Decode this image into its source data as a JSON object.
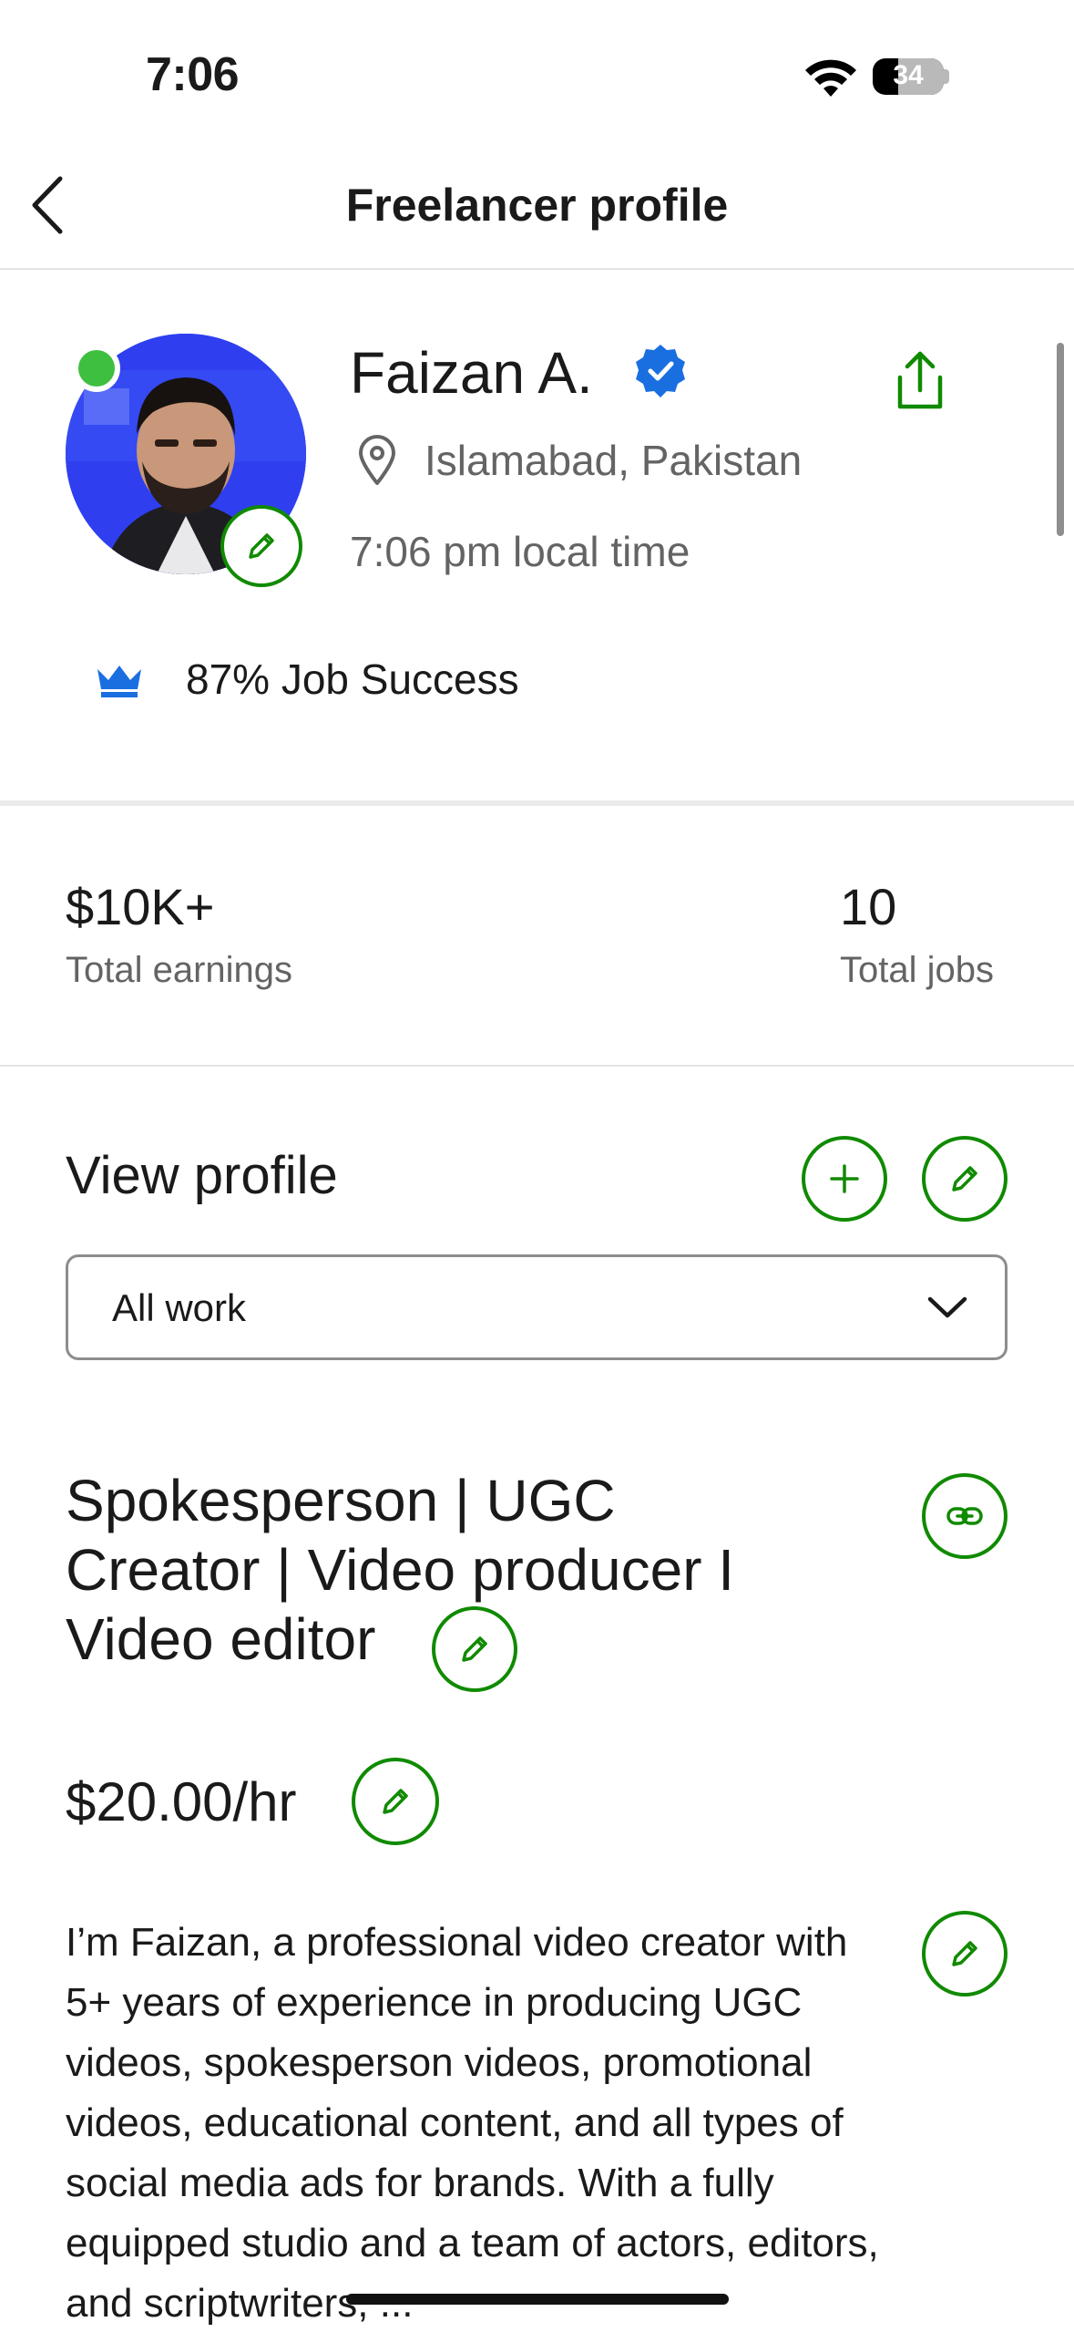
{
  "status_bar": {
    "time": "7:06",
    "battery": "34"
  },
  "nav": {
    "title": "Freelancer profile"
  },
  "profile": {
    "name": "Faizan A.",
    "location": "Islamabad, Pakistan",
    "local_time": "7:06 pm local time",
    "job_success": "87% Job Success"
  },
  "stats": {
    "earnings_value": "$10K+",
    "earnings_label": "Total earnings",
    "jobs_value": "10",
    "jobs_label": "Total jobs"
  },
  "view_profile": {
    "title": "View profile",
    "dropdown_selected": "All work"
  },
  "work": {
    "headline": "Spokesperson | UGC Creator | Video producer I Video editor",
    "rate": "$20.00/hr",
    "bio": "I’m Faizan, a professional video creator with 5+ years of experience in producing UGC videos, spokesperson videos, promotional videos, educational content, and all types of social media ads for brands. With a fully equipped studio and a team of actors, editors, and scriptwriters, ..."
  },
  "colors": {
    "accent": "#108a00",
    "verified": "#1a6fe0",
    "crown": "#1a6fe0",
    "online": "#3fbf3f"
  }
}
